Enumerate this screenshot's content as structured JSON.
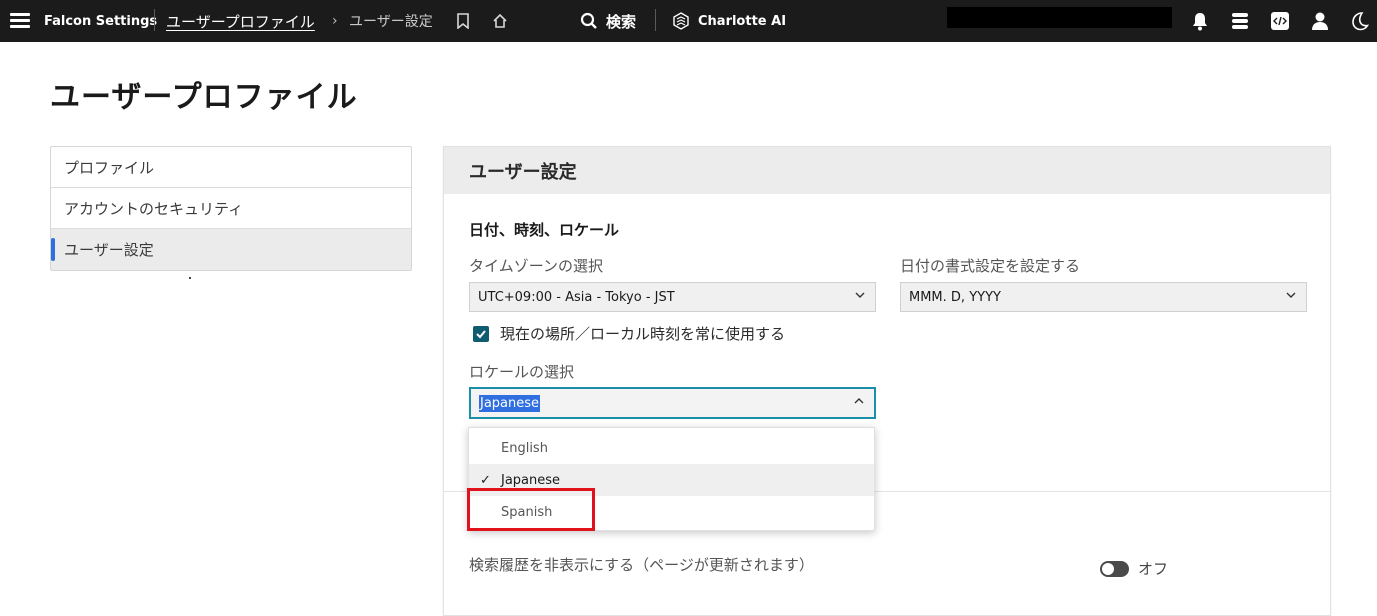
{
  "topbar": {
    "app_title": "Falcon Settings",
    "breadcrumb_link": "ユーザープロファイル",
    "breadcrumb_separator": "›",
    "breadcrumb_current": "ユーザー設定",
    "search_label": "検索",
    "charlotte_label": "Charlotte AI",
    "icons": [
      "menu-icon",
      "bookmark-icon",
      "home-icon",
      "search-icon",
      "charlotte-ai-icon",
      "bell-icon",
      "stack-icon",
      "code-icon",
      "user-icon",
      "moon-icon"
    ]
  },
  "page": {
    "title": "ユーザープロファイル"
  },
  "sidebar": {
    "items": [
      {
        "label": "プロファイル",
        "active": false
      },
      {
        "label": "アカウントのセキュリティ",
        "active": false
      },
      {
        "label": "ユーザー設定",
        "active": true
      }
    ]
  },
  "panel": {
    "header": "ユーザー設定",
    "section_title": "日付、時刻、ロケール",
    "timezone": {
      "label": "タイムゾーンの選択",
      "value": "UTC+09:00 - Asia - Tokyo - JST"
    },
    "date_format": {
      "label": "日付の書式設定を設定する",
      "value": "MMM. D, YYYY"
    },
    "use_local_time": {
      "label": "現在の場所／ローカル時刻を常に使用する",
      "checked": true
    },
    "locale": {
      "label": "ロケールの選択",
      "value": "Japanese",
      "options": [
        {
          "label": "English",
          "selected": false
        },
        {
          "label": "Japanese",
          "selected": true
        },
        {
          "label": "Spanish",
          "selected": false
        }
      ],
      "check_glyph": "✓"
    },
    "search_history": {
      "label": "検索履歴を非表示にする（ページが更新されます）",
      "toggle_label": "オフ",
      "on": false
    }
  },
  "colors": {
    "topbar_bg": "#1b1b1b",
    "accent_blue": "#2f6fe0",
    "checkbox_teal": "#0f5c70",
    "focus_border": "#1c8fa8",
    "highlight_red": "#e0121b"
  }
}
